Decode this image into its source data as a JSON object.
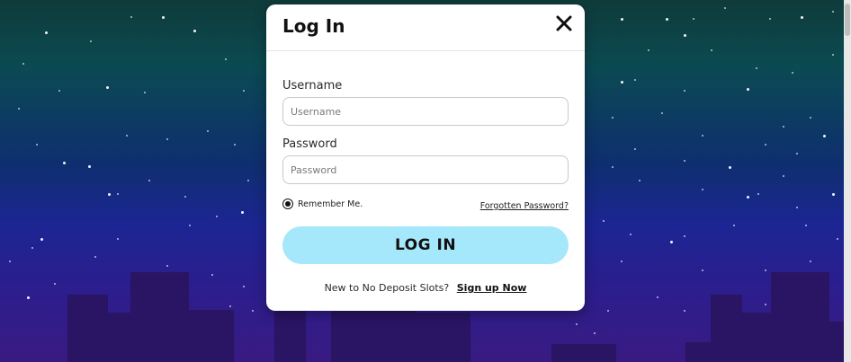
{
  "modal": {
    "title": "Log In",
    "username_label": "Username",
    "username_placeholder": "Username",
    "password_label": "Password",
    "password_placeholder": "Password",
    "remember_label": "Remember Me.",
    "forgot_label": "Forgotten Password?",
    "login_button": "LOG IN",
    "signup_prompt": "New to No Deposit Slots?",
    "signup_link": "Sign up Now"
  },
  "colors": {
    "login_button_bg": "#a6e8fb",
    "sky_top": "#0f3b3a",
    "sky_bottom": "#3a1a82"
  },
  "icons": {
    "close": "close-icon",
    "remember_radio": "radio-selected-icon"
  }
}
